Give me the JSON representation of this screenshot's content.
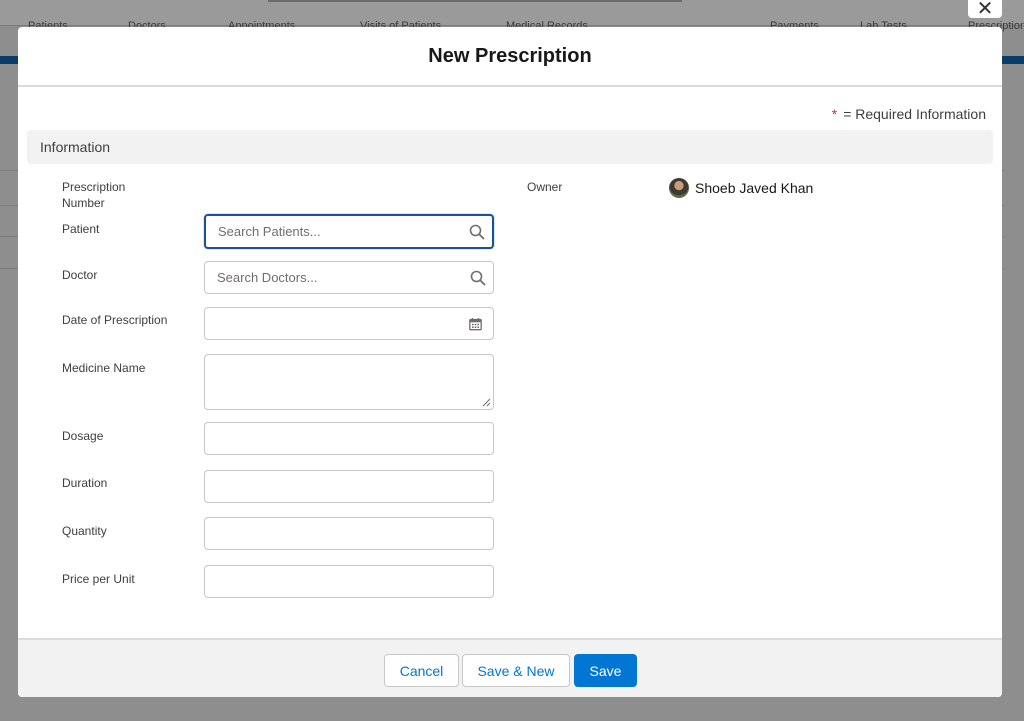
{
  "background": {
    "tabs": [
      "Patients",
      "Doctors",
      "Appointments",
      "Visits of Patients",
      "Medical Records",
      "Payments",
      "Lab Tests",
      "Prescriptions"
    ],
    "close_icon": "close-icon"
  },
  "modal": {
    "title": "New Prescription",
    "required_star": "*",
    "required_text": "= Required Information",
    "section_title": "Information"
  },
  "fields": {
    "prescription_number": {
      "label": "Prescription Number"
    },
    "patient": {
      "label": "Patient",
      "placeholder": "Search Patients...",
      "value": "",
      "icon": "search-icon"
    },
    "doctor": {
      "label": "Doctor",
      "placeholder": "Search Doctors...",
      "value": "",
      "icon": "search-icon"
    },
    "date": {
      "label": "Date of Prescription",
      "value": "",
      "icon": "calendar-icon"
    },
    "medicine": {
      "label": "Medicine Name",
      "value": ""
    },
    "dosage": {
      "label": "Dosage",
      "value": ""
    },
    "duration": {
      "label": "Duration",
      "value": ""
    },
    "quantity": {
      "label": "Quantity",
      "value": ""
    },
    "price": {
      "label": "Price per Unit",
      "value": ""
    }
  },
  "owner": {
    "label": "Owner",
    "name": "Shoeb Javed Khan"
  },
  "footer": {
    "cancel": "Cancel",
    "save_new": "Save & New",
    "save": "Save"
  },
  "colors": {
    "brand": "#0176d3",
    "focus_border": "#1b5297",
    "required": "#c23934"
  }
}
